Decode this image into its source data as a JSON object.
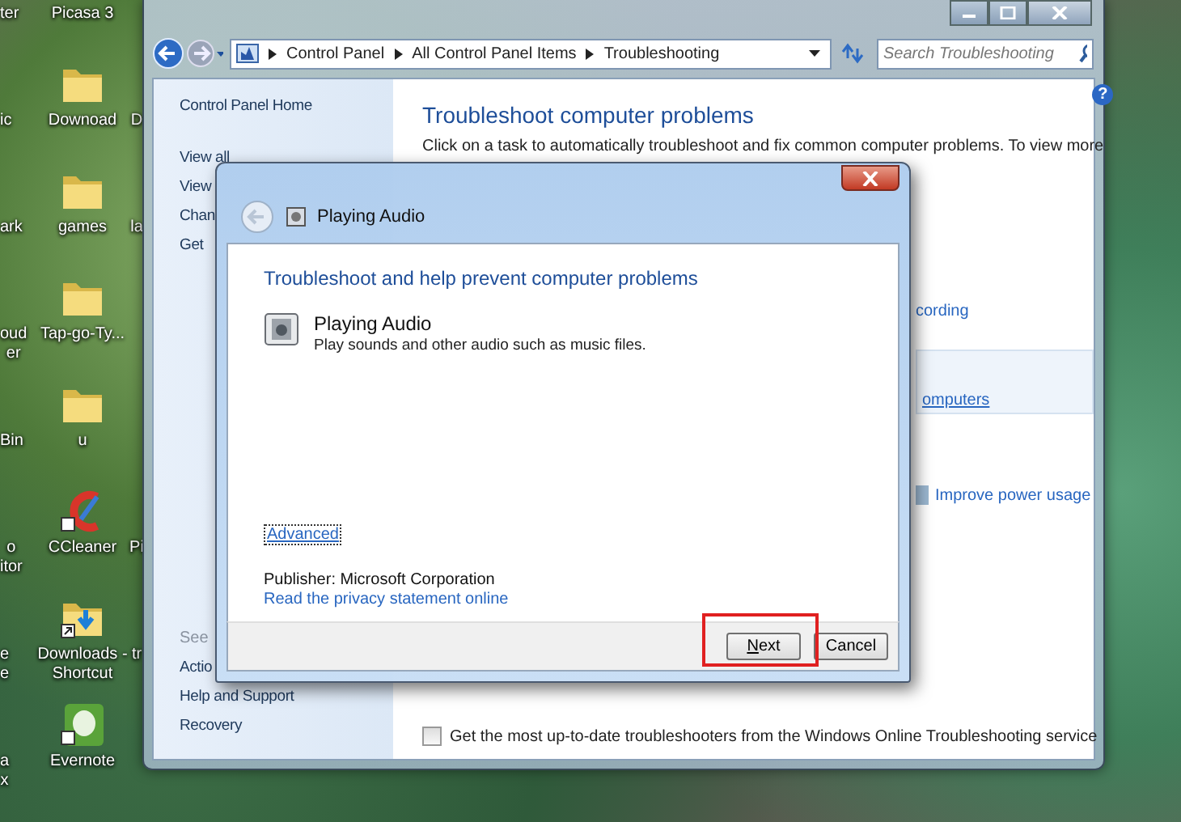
{
  "desktop": {
    "columns": [
      [
        {
          "kind": "none",
          "label": "ter"
        },
        {
          "kind": "none",
          "label": "ic"
        },
        {
          "kind": "none",
          "label": "ark"
        },
        {
          "kind": "none",
          "label": "oud\ner"
        },
        {
          "kind": "none",
          "label": "Bin"
        },
        {
          "kind": "none",
          "label": "o\nitor"
        },
        {
          "kind": "none",
          "label": "e\ne"
        },
        {
          "kind": "none",
          "label": "a\nx"
        }
      ],
      [
        {
          "kind": "none",
          "label": "Picasa 3"
        },
        {
          "kind": "folder",
          "label": "Downoad"
        },
        {
          "kind": "folder",
          "label": "games"
        },
        {
          "kind": "folder",
          "label": "Tap-go-Ty..."
        },
        {
          "kind": "folder",
          "label": "u"
        },
        {
          "kind": "brush",
          "label": "CCleaner"
        },
        {
          "kind": "shortcut-folder",
          "label": "Downloads -\nShortcut"
        },
        {
          "kind": "elephant",
          "label": "Evernote"
        }
      ],
      [
        {
          "kind": "blank"
        },
        {
          "kind": "none",
          "label": "D"
        },
        {
          "kind": "none",
          "label": "la"
        },
        {
          "kind": "blank"
        },
        {
          "kind": "blank"
        },
        {
          "kind": "none",
          "label": "Pi"
        },
        {
          "kind": "none",
          "label": "tr"
        },
        {
          "kind": "blank"
        }
      ]
    ]
  },
  "control_panel": {
    "breadcrumb": [
      "Control Panel",
      "All Control Panel Items",
      "Troubleshooting"
    ],
    "search": {
      "placeholder": "Search Troubleshooting"
    },
    "help": "?",
    "sidebar": {
      "top": [
        "Control Panel Home",
        "View all",
        "View",
        "Chan",
        "Get"
      ],
      "see_also_heading": "See",
      "see_also": [
        "Actio",
        "Help and Support",
        "Recovery"
      ]
    },
    "title": "Troubleshoot computer problems",
    "description": "Click on a task to automatically troubleshoot and fix common computer problems. To view more",
    "peeks": [
      {
        "kind": "text",
        "label": "cording"
      },
      {
        "kind": "boxlink",
        "label": "omputers"
      },
      {
        "kind": "iconlink",
        "label": "Improve power usage"
      }
    ],
    "online_option": {
      "label": "Get the most up-to-date troubleshooters from the Windows Online Troubleshooting service",
      "checked": false
    }
  },
  "dialog": {
    "title": "Playing Audio",
    "heading": "Troubleshoot and help prevent computer problems",
    "item": {
      "name": "Playing Audio",
      "description": "Play sounds and other audio such as music files."
    },
    "advanced": {
      "label": "Advanced",
      "focused": true
    },
    "publisher": "Publisher:  Microsoft Corporation",
    "privacy_link": "Read the privacy statement online",
    "buttons": [
      {
        "label": "Next",
        "underline_first": true,
        "highlighted": true
      },
      {
        "label": "Cancel",
        "underline_first": false,
        "highlighted": false
      }
    ]
  }
}
